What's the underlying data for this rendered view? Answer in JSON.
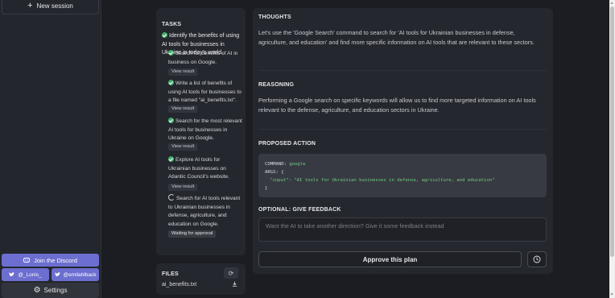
{
  "sidebar": {
    "new_session_label": "New session",
    "discord_label": "Join the Discord",
    "twitter_1": "@_Lonis_",
    "twitter_2": "@emilahlback",
    "settings_label": "Settings"
  },
  "tasks": {
    "title": "TASKS",
    "main_task": "Identify the benefits of using AI tools for businesses in Ukraine in today's world.",
    "subtasks": [
      {
        "label": "Search for benefits of AI in business on Google.",
        "status": "done",
        "button": "View result"
      },
      {
        "label": "Write a list of benefits of using AI tools for businesses to a file named \"ai_benefits.txt\".",
        "status": "done",
        "button": "View result"
      },
      {
        "label": "Search for the most relevant AI tools for businesses in Ukraine on Google.",
        "status": "done",
        "button": "View result"
      },
      {
        "label": "Explore AI tools for Ukrainian businesses on Atlantic Council's website.",
        "status": "done",
        "button": "View result"
      },
      {
        "label": "Search for AI tools relevant to Ukrainian businesses in defense, agriculture, and education on Google.",
        "status": "pending",
        "button": "Waiting for approval"
      }
    ]
  },
  "files": {
    "title": "FILES",
    "items": [
      "ai_benefits.txt"
    ]
  },
  "main": {
    "thoughts_title": "THOUGHTS",
    "thoughts_text": "Let's use the 'Google Search' command to search for 'AI tools for Ukrainian businesses in defense, agriculture, and education' and find more specific information on AI tools that are relevant to these sectors.",
    "reasoning_title": "REASONING",
    "reasoning_text": "Performing a Google search on specific keywords will allow us to find more targeted information on AI tools relevant to the defense, agriculture, and education sectors in Ukraine.",
    "proposed_title": "PROPOSED ACTION",
    "code": {
      "command_key": "COMMAND:",
      "command_value": "google",
      "args_key": "ARGS: {",
      "input_line": "\"input\": \"AI tools for Ukrainian businesses in defense, agriculture, and education\"",
      "close": "}"
    },
    "feedback_title": "OPTIONAL: GIVE FEEDBACK",
    "feedback_placeholder": "Want the AI to take another direction? Give it some feedback instead",
    "approve_label": "Approve this plan"
  },
  "colors": {
    "accent": "#6c6fcf",
    "success": "#3fb06b",
    "panel": "#25272e",
    "background": "#1b1d23"
  }
}
